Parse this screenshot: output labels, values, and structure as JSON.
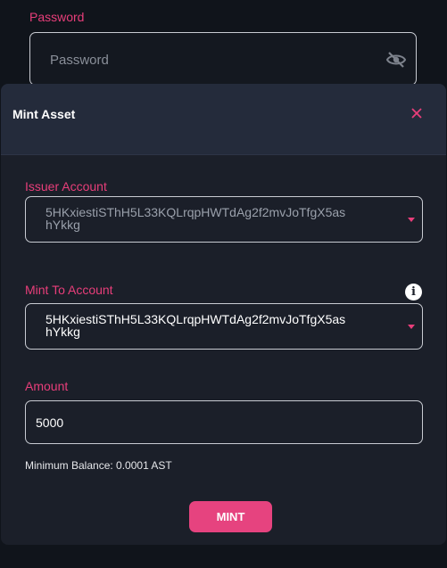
{
  "background_form": {
    "password_label": "Password",
    "password_placeholder": "Password",
    "visibility_icon": "eye-off-icon"
  },
  "modal": {
    "title": "Mint Asset",
    "close_icon": "close-icon",
    "issuer_account": {
      "label": "Issuer Account",
      "value": "5HKxiestiSThH5L33KQLrqpHWTdAg2f2mvJoTfgX5ashYkkg",
      "value_line1": "5HKxiestiSThH5L33KQLrqpHWTdAg2f2mvJoTfgX5as",
      "value_line2": "hYkkg"
    },
    "mint_to_account": {
      "label": "Mint To Account",
      "info_icon": "info-icon",
      "value": "5HKxiestiSThH5L33KQLrqpHWTdAg2f2mvJoTfgX5ashYkkg",
      "value_line1": "5HKxiestiSThH5L33KQLrqpHWTdAg2f2mvJoTfgX5as",
      "value_line2": "hYkkg"
    },
    "amount": {
      "label": "Amount",
      "value": "5000"
    },
    "minimum_balance": "Minimum Balance: 0.0001 AST",
    "mint_button": "MINT"
  },
  "colors": {
    "accent": "#e83e7a",
    "background": "#10141b",
    "modal_bg": "#1b1f29",
    "modal_header_bg": "#242b3b"
  }
}
